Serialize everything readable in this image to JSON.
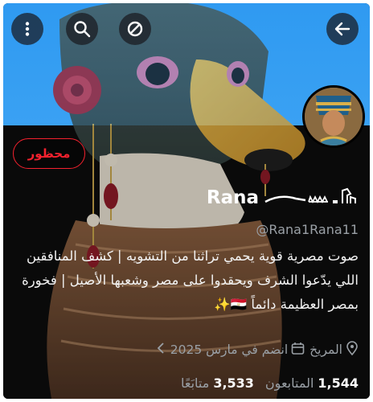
{
  "topbar": {
    "menu_icon": "more-vertical-icon",
    "search_icon": "search-icon",
    "blocked_icon": "no-entry-icon",
    "back_icon": "arrow-left-icon"
  },
  "profile": {
    "blocked_label": "محظور",
    "display_name": "Rana",
    "name_glyphs": "𓂀 𓇋𓈖𓅓",
    "handle": "@Rana1Rana11",
    "bio_lines": [
      "صوت مصرية قوية يحمي تراثنا من التشويه | كشف المنافقين",
      "اللي يدّعوا الشرف ويحقدوا على مصر وشعبها الأصيل | فخورة",
      "بمصر العظيمة دائماً 🇪🇬✨"
    ],
    "location": "المريخ",
    "joined": "انضم في مارس 2025"
  },
  "stats": {
    "followers_count": "1,544",
    "followers_label": "المتابعون",
    "following_count": "3,533",
    "following_label": "متابَعًا"
  },
  "colors": {
    "accent_red": "#f4212e",
    "banner_blue": "#3aa1f3"
  }
}
